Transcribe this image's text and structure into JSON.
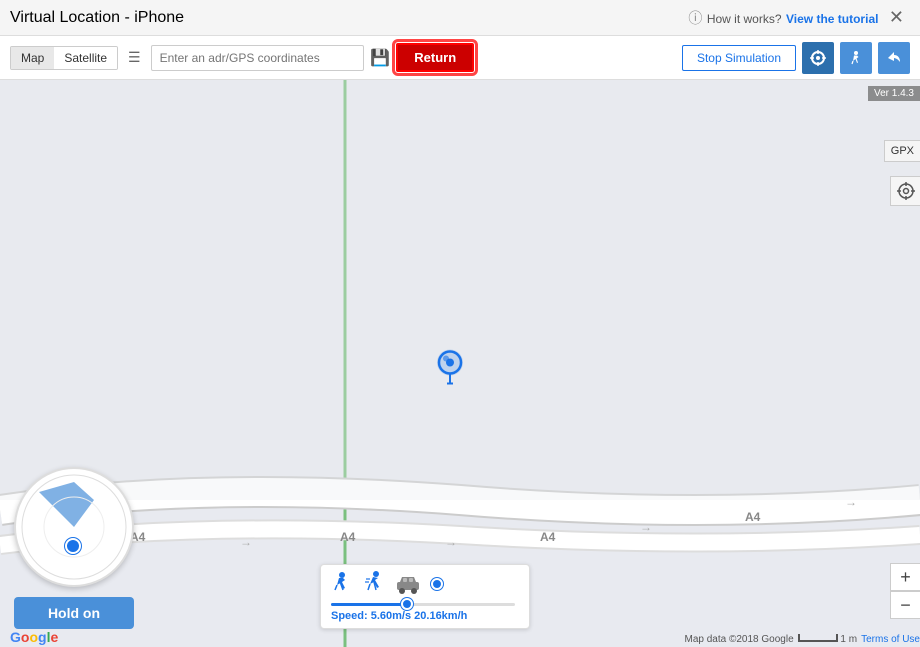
{
  "titlebar": {
    "title": "Virtual Location - iPhone",
    "help_text": "How it works?",
    "tutorial_link": "View the tutorial"
  },
  "toolbar": {
    "map_label": "Map",
    "satellite_label": "Satellite",
    "coord_placeholder": "Enter an adr/GPS coordinates",
    "return_label": "Return",
    "stop_sim_label": "Stop Simulation"
  },
  "map": {
    "version": "Ver 1.4.3",
    "gpx_label": "GPX",
    "road_labels": [
      "A4",
      "A4",
      "A4",
      "A4"
    ],
    "zoom_in": "+",
    "zoom_out": "−"
  },
  "speed_widget": {
    "speed_text": "Speed: ",
    "speed_value": "5.60m/s 20.16km/h"
  },
  "hold_on_btn": "Hold on",
  "attribution": {
    "text": "Map data ©2018 Google",
    "scale": "1 m",
    "terms": "Terms of Use"
  },
  "google_logo": "Google"
}
